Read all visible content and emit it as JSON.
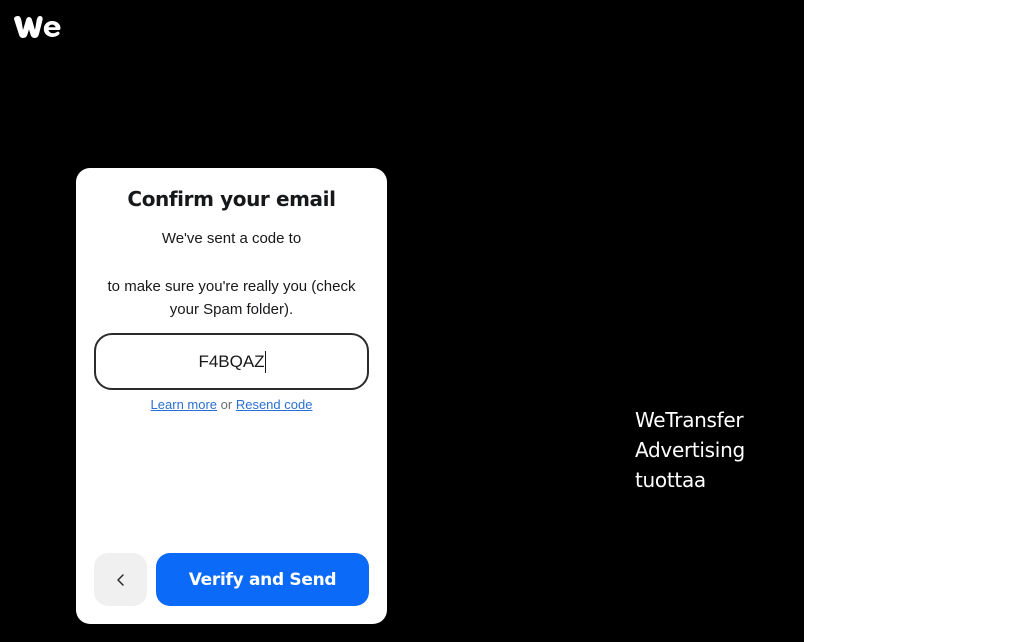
{
  "brand": {
    "logo_text": "we",
    "panel_color": "#000000",
    "accent_color": "#0b6af8"
  },
  "card": {
    "title": "Confirm your email",
    "sent_text": "We've sent a code to",
    "sure_text": "to make sure you're really you (check your Spam folder).",
    "code_value": "F4BQAZ",
    "links": {
      "learn_more": "Learn more",
      "separator": "or",
      "resend_code": "Resend code"
    },
    "back_icon": "chevron-left-icon",
    "verify_label": "Verify and Send"
  },
  "ad": {
    "line1": "WeTransfer",
    "line2": "Advertising",
    "line3": "tuottaa"
  }
}
